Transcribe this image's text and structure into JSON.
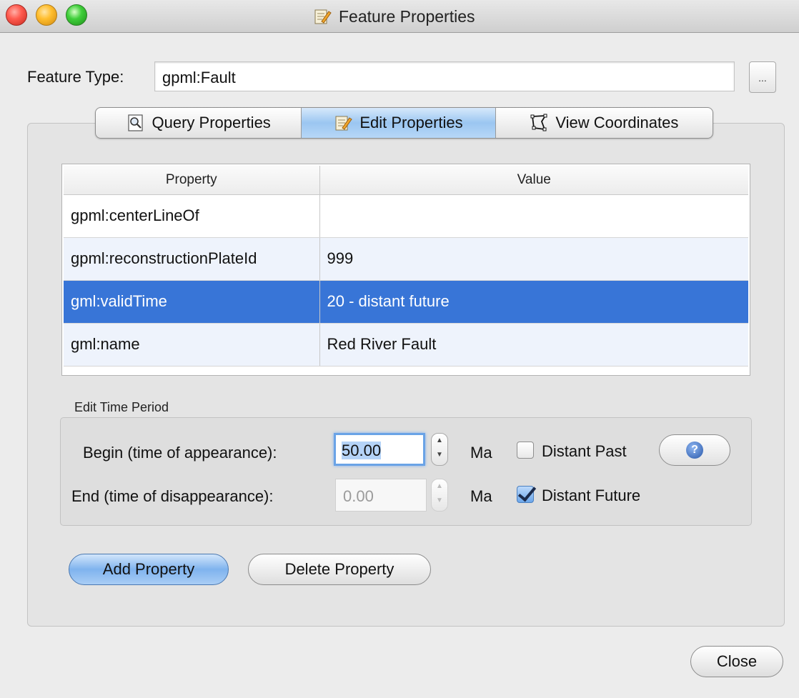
{
  "window": {
    "title": "Feature Properties"
  },
  "feature_type": {
    "label": "Feature Type:",
    "value": "gpml:Fault",
    "browse_label": "..."
  },
  "tabs": [
    {
      "label": "Query Properties",
      "icon": "magnifier-icon",
      "selected": false
    },
    {
      "label": "Edit Properties",
      "icon": "edit-pencil-icon",
      "selected": true
    },
    {
      "label": "View Coordinates",
      "icon": "polygon-icon",
      "selected": false
    }
  ],
  "table": {
    "headers": [
      "Property",
      "Value"
    ],
    "rows": [
      {
        "property": "gpml:centerLineOf",
        "value": ""
      },
      {
        "property": "gpml:reconstructionPlateId",
        "value": "999"
      },
      {
        "property": "gml:validTime",
        "value": "20 - distant future",
        "selected": true
      },
      {
        "property": "gml:name",
        "value": "Red River Fault"
      }
    ]
  },
  "time_period": {
    "title": "Edit Time Period",
    "begin_label": "Begin (time of appearance):",
    "begin_value": "50.00",
    "end_label": "End (time of disappearance):",
    "end_value": "0.00",
    "unit": "Ma",
    "distant_past_label": "Distant Past",
    "distant_past_checked": false,
    "distant_future_label": "Distant Future",
    "distant_future_checked": true
  },
  "buttons": {
    "add_property": "Add Property",
    "delete_property": "Delete Property",
    "close": "Close"
  }
}
